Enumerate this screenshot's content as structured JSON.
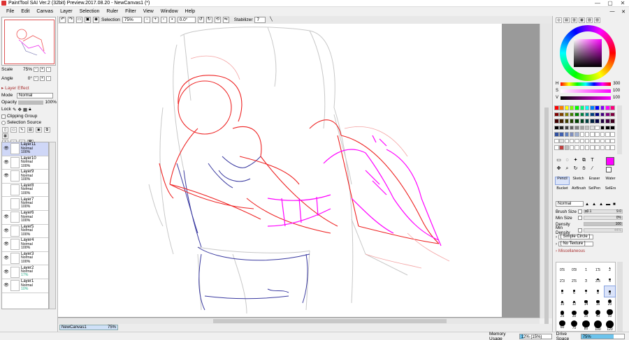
{
  "window": {
    "title": "PaintTool SAI Ver.2 (32bit) Preview.2017.08.20 - NewCanvas1 (*)",
    "minimize": "—",
    "maximize": "▢",
    "close": "✕"
  },
  "menu": [
    "File",
    "Edit",
    "Canvas",
    "Layer",
    "Selection",
    "Ruler",
    "Filter",
    "View",
    "Window",
    "Help"
  ],
  "toolbar": {
    "selection_label": "Selection",
    "zoom_value": "75%",
    "angle_value": "0.0°",
    "stabilizer_label": "Stabilizer",
    "stabilizer_value": "7"
  },
  "left": {
    "scale_label": "Scale",
    "scale_value": "75%",
    "angle_label": "Angle",
    "angle_value": "0°",
    "layer_effect": "Layer Effect",
    "mode_label": "Mode",
    "mode_value": "Normal",
    "opacity_label": "Opacity",
    "opacity_value": "100%",
    "lock_label": "Lock",
    "clipping_group": "Clipping Group",
    "selection_source": "Selection Source"
  },
  "layers": [
    {
      "name": "Layer11",
      "mode": "Normal",
      "opacity": "100%",
      "visible": true,
      "selected": true
    },
    {
      "name": "Layer10",
      "mode": "Normal",
      "opacity": "100%",
      "visible": true,
      "selected": false
    },
    {
      "name": "Layer9",
      "mode": "Normal",
      "opacity": "100%",
      "visible": true,
      "selected": false
    },
    {
      "name": "Layer8",
      "mode": "Normal",
      "opacity": "100%",
      "visible": false,
      "selected": false
    },
    {
      "name": "Layer7",
      "mode": "Normal",
      "opacity": "100%",
      "visible": false,
      "selected": false
    },
    {
      "name": "Layer6",
      "mode": "Normal",
      "opacity": "100%",
      "visible": true,
      "selected": false
    },
    {
      "name": "Layer5",
      "mode": "Normal",
      "opacity": "100%",
      "visible": true,
      "selected": false
    },
    {
      "name": "Layer4",
      "mode": "Normal",
      "opacity": "100%",
      "visible": true,
      "selected": false
    },
    {
      "name": "Layer3",
      "mode": "Normal",
      "opacity": "100%",
      "visible": true,
      "selected": false
    },
    {
      "name": "Layer2",
      "mode": "Normal",
      "opacity": "17%",
      "visible": true,
      "selected": false
    },
    {
      "name": "Layer1",
      "mode": "Normal",
      "opacity": "10%",
      "visible": true,
      "selected": false
    }
  ],
  "canvas_tab": {
    "name": "NewCanvas1",
    "zoom": "75%"
  },
  "status": {
    "memory_label": "Memory Usage",
    "memory_value": "12% (15%)",
    "memory_fraction": 0.12,
    "drive_label": "Drive Space",
    "drive_value": "75%",
    "drive_fraction": 0.75
  },
  "color": {
    "current": "#ff00ff",
    "background": "#ffffff",
    "h_label": "H",
    "h_value": "300",
    "s_label": "S",
    "s_value": "100",
    "v_label": "V",
    "v_value": "100"
  },
  "tools": {
    "row1": [
      "Pencil",
      "Sketch",
      "Eraser",
      "Water"
    ],
    "row2": [
      "Bucket",
      "AirBrush",
      "SelPen",
      "SelErs"
    ],
    "selected": "Pencil"
  },
  "brush": {
    "blend_mode": "Normal",
    "size_label": "Brush Size",
    "size_multiplier": "x0.1",
    "size_value": "9.0",
    "min_size_label": "Min Size",
    "min_size_value": "0%",
    "density_label": "Density",
    "density_value": "100",
    "min_density_label": "Min Density",
    "min_density_value": "44%",
    "shape": "[ Simple Circle ]",
    "texture": "[ No Texture ]",
    "misc": "Miscellaneous"
  },
  "brush_sizes": [
    "0.6",
    "0.8",
    "1",
    "1.5",
    "2",
    "2.3",
    "2.6",
    "3",
    "3.5",
    "4",
    "5",
    "6",
    "7",
    "8",
    "9",
    "10",
    "12",
    "14",
    "16",
    "20",
    "25",
    "30",
    "35",
    "40",
    "50",
    "60",
    "70",
    "80",
    "100",
    "120"
  ]
}
